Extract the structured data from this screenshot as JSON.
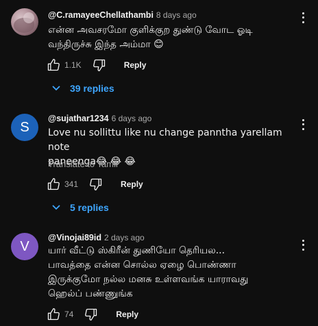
{
  "colors": {
    "background": "#0f0f0f",
    "link_blue": "#3ea6ff",
    "secondary_text": "#aaaaaa"
  },
  "comments": [
    {
      "author": "@C.ramayeeChellathambi",
      "time": "8 days ago",
      "avatar": "photo",
      "text": "என்ன அவசரமோ குளிக்குற துண்டு வோட ஓடி\nவந்திருச்சு இந்த அம்மா 😊",
      "likes": "1.1K",
      "reply_label": "Reply",
      "replies_label": "39 replies"
    },
    {
      "author": "@sujathar1234",
      "time": "6 days ago",
      "avatar_letter": "S",
      "text": "Love nu sollittu like nu change panntha yarellam  note\npaneenga😂 😂 😂",
      "translate_label": "Translate to Tamil",
      "likes": "341",
      "reply_label": "Reply",
      "replies_label": "5 replies"
    },
    {
      "author": "@Vinojai89id",
      "time": "2 days ago",
      "avatar_letter": "V",
      "text": "யார் வீட்டு ஸ்கிரீன் துணியோ தெரியல...\nபாவத்தை என்ன சொல்ல ஏழை பொண்ணா\nஇருக்குமோ நல்ல மனசு உள்ளவங்க யாராவது\nஹெல்ப் பண்ணுங்க",
      "likes": "74",
      "reply_label": "Reply"
    }
  ]
}
